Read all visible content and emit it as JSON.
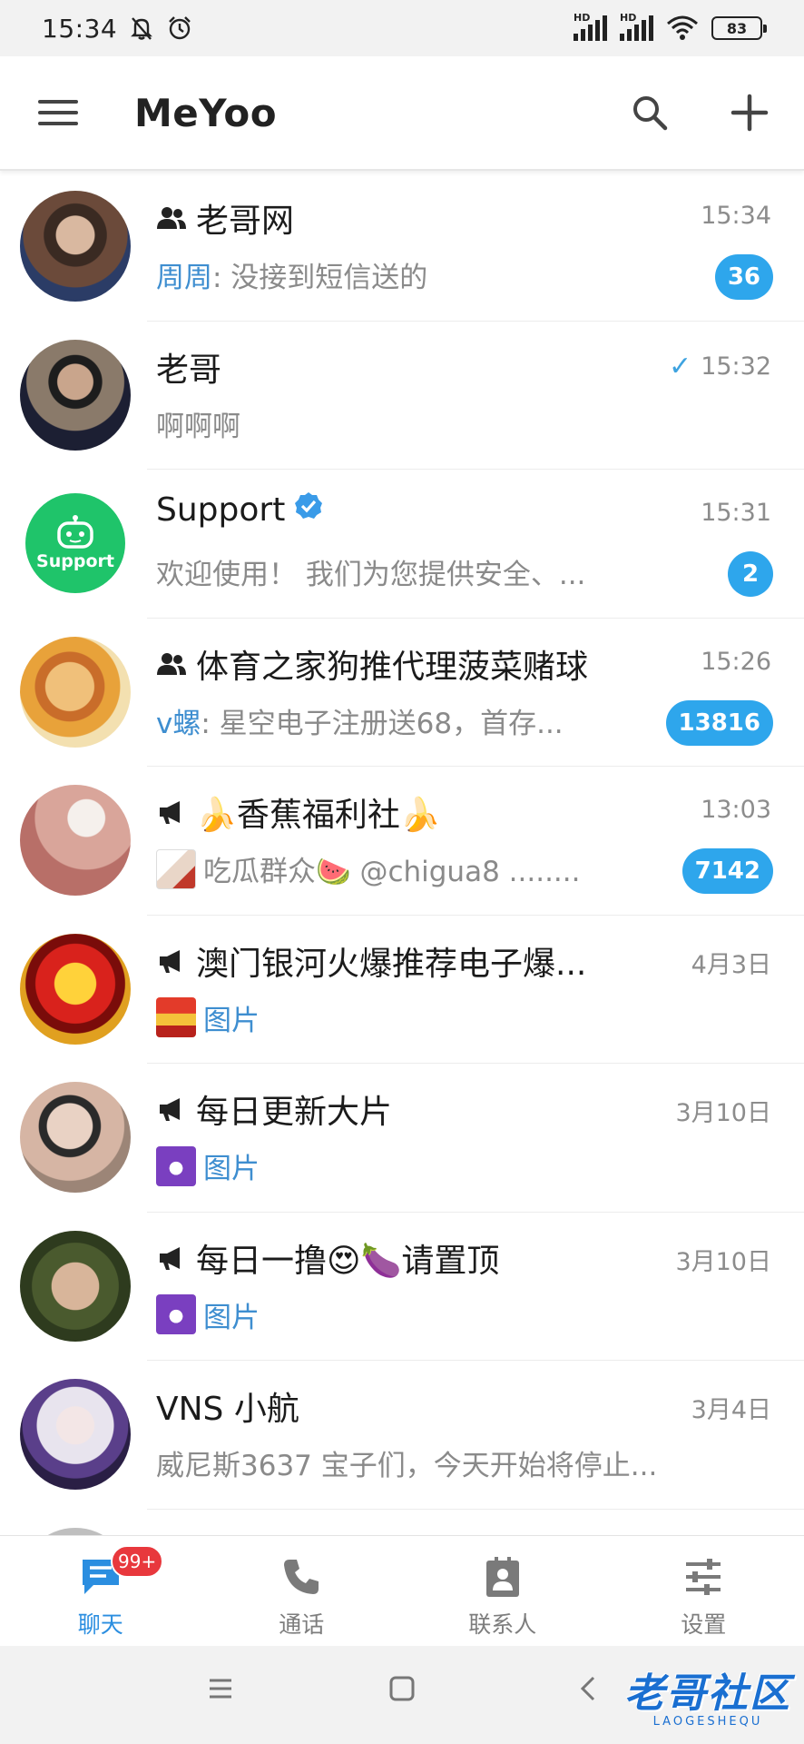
{
  "status_bar": {
    "time": "15:34",
    "signal1_label": "HD",
    "signal2_label": "HD",
    "battery": "83",
    "icons": [
      "mute-icon",
      "alarm-icon",
      "signal-icon",
      "wifi-icon",
      "battery-icon"
    ]
  },
  "app_bar": {
    "title": "MeYoo",
    "icons": [
      "menu-icon",
      "search-icon",
      "add-icon"
    ]
  },
  "chats": [
    {
      "name": "老哥网",
      "type": "group",
      "time": "15:34",
      "sender": "周周",
      "message": ": 没接到短信送的",
      "unread": "36"
    },
    {
      "name": "老哥",
      "type": "private",
      "time": "15:32",
      "read": true,
      "message": "啊啊啊"
    },
    {
      "name": "Support",
      "type": "bot",
      "verified": true,
      "time": "15:31",
      "message": "欢迎使用！ 我们为您提供安全、...",
      "unread": "2",
      "avatar_label": "Support"
    },
    {
      "name": "体育之家狗推代理菠菜赌球",
      "type": "group",
      "time": "15:26",
      "sender": "v螺",
      "message": ": 星空电子注册送68，首存...",
      "unread": "13816"
    },
    {
      "name": "🍌香蕉福利社🍌",
      "type": "channel",
      "time": "13:03",
      "message": "吃瓜群众🍉 @chigua8 ........",
      "unread": "7142"
    },
    {
      "name": "澳门银河火爆推荐电子爆...",
      "type": "channel",
      "time": "4月3日",
      "media": "图片"
    },
    {
      "name": "每日更新大片",
      "type": "channel",
      "time": "3月10日",
      "media": "图片"
    },
    {
      "name": "每日一撸😍🍆请置顶",
      "type": "channel",
      "time": "3月10日",
      "media": "图片"
    },
    {
      "name": "VNS 小航",
      "type": "private",
      "time": "3月4日",
      "message": "威尼斯3637 宝子们，今天开始将停止..."
    }
  ],
  "bottom_nav": [
    {
      "label": "聊天",
      "icon": "chat-icon",
      "active": true,
      "badge": "99+"
    },
    {
      "label": "通话",
      "icon": "phone-icon",
      "active": false
    },
    {
      "label": "联系人",
      "icon": "contacts-icon",
      "active": false
    },
    {
      "label": "设置",
      "icon": "settings-icon",
      "active": false
    }
  ],
  "watermark": {
    "main": "老哥社区",
    "sub": "LAOGESHEQU"
  },
  "colors": {
    "accent": "#2ea6ec",
    "link": "#3e8ed0",
    "badge_red": "#e8383d",
    "nav_active": "#2b8ee0"
  }
}
